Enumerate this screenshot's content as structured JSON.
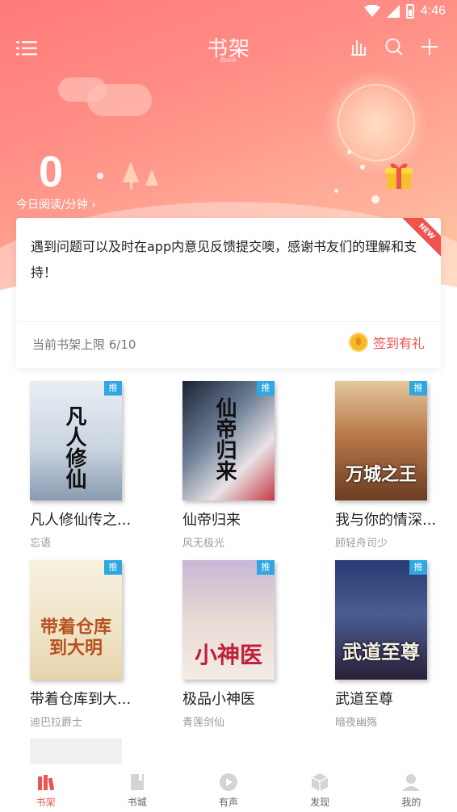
{
  "status_bar": {
    "time": "4:46"
  },
  "header": {
    "title": "书架",
    "title_sub": "Book",
    "reading_count": "0",
    "reading_label": "今日阅读/分钟 ›"
  },
  "notice": {
    "badge": "NEW",
    "text": "遇到问题可以及时在app内意见反馈提交噢，感谢书友们的理解和支持！",
    "shelf_limit": "当前书架上限 6/10",
    "checkin_label": "签到有礼"
  },
  "books": [
    {
      "title": "凡人修仙传之...",
      "author": "忘语",
      "badge": "推",
      "cover_text": "凡人修仙",
      "cover_bg": "#dfe6ee",
      "cover_fg": "#111"
    },
    {
      "title": "仙帝归来",
      "author": "风无极光",
      "badge": "推",
      "cover_text": "仙帝归来",
      "cover_bg": "#b9c6d6",
      "cover_fg": "#111"
    },
    {
      "title": "我与你的情深...",
      "author": "顾轻舟司少",
      "badge": "推",
      "cover_text": "万城之王",
      "cover_bg": "#a36a3f",
      "cover_fg": "#ffffff"
    },
    {
      "title": "带着仓库到大...",
      "author": "迪巴拉爵士",
      "badge": "推",
      "cover_text": "带着仓库到大明",
      "cover_bg": "#f3ecd9",
      "cover_fg": "#b6521f"
    },
    {
      "title": "极品小神医",
      "author": "青莲剑仙",
      "badge": "推",
      "cover_text": "小神医",
      "cover_bg": "#e9d7cf",
      "cover_fg": "#c0203a"
    },
    {
      "title": "武道至尊",
      "author": "暗夜幽殇",
      "badge": "推",
      "cover_text": "武道至尊",
      "cover_bg": "#3b4a7a",
      "cover_fg": "#f5f0e0"
    }
  ],
  "tabs": [
    {
      "label": "书架",
      "icon": "bookshelf-icon",
      "active": true
    },
    {
      "label": "书城",
      "icon": "bookstore-icon",
      "active": false
    },
    {
      "label": "有声",
      "icon": "audio-play-icon",
      "active": false
    },
    {
      "label": "发现",
      "icon": "discover-cube-icon",
      "active": false
    },
    {
      "label": "我的",
      "icon": "profile-icon",
      "active": false
    }
  ],
  "colors": {
    "accent": "#f0524f",
    "badge_blue": "#2fa7e1",
    "coin": "#f6b928"
  }
}
